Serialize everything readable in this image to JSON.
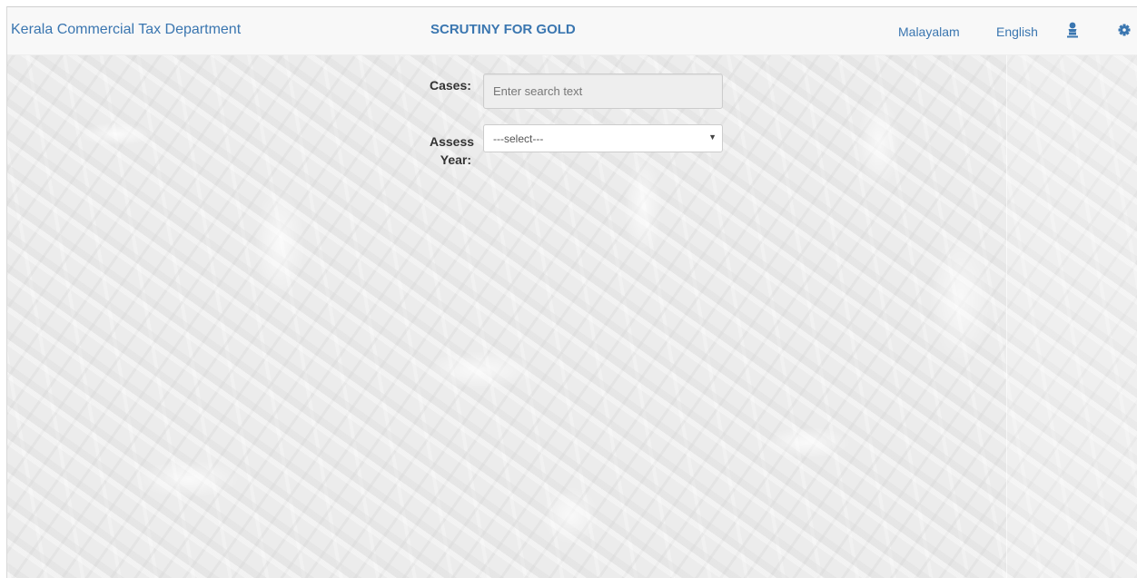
{
  "header": {
    "brand": "Kerala Commercial Tax Department",
    "title": "SCRUTINY FOR GOLD",
    "nav": {
      "malayalam": "Malayalam",
      "english": "English"
    },
    "icons": {
      "user": "user-icon",
      "settings": "gear-icon"
    }
  },
  "form": {
    "cases_label": "Cases:",
    "search_placeholder": "Enter search text",
    "search_value": "",
    "assess_label_line1": "Assess",
    "assess_label_line2": "Year:",
    "assess_selected": "---select---"
  },
  "colors": {
    "accent": "#3a76b0",
    "navbar_bg": "#f8f8f8"
  }
}
